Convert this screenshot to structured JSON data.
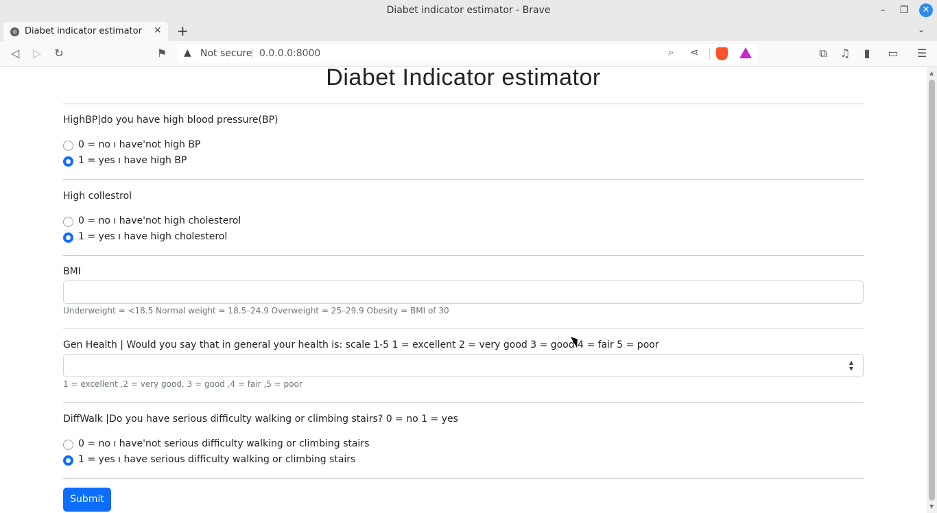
{
  "window": {
    "title": "Diabet indicator estimator - Brave"
  },
  "tab": {
    "title": "Diabet indicator estimator",
    "close_icon": "×",
    "new_tab_icon": "+",
    "list_icon": "⌄"
  },
  "addressbar": {
    "security_label": "Not secure",
    "url": "0.0.0.0:8000"
  },
  "page": {
    "heading": "Diabet İndicator estimator",
    "highbp": {
      "label": "HighBP|do you have high blood pressure(BP)",
      "options": [
        "0 = no ı have'not high BP",
        "1 = yes ı have high BP"
      ],
      "selected": 1
    },
    "highchol": {
      "label": "High collestrol",
      "options": [
        "0 = no ı have'not high cholesterol",
        "1 = yes ı have high cholesterol"
      ],
      "selected": 1
    },
    "bmi": {
      "label": "BMI",
      "value": "",
      "help": "Underweight = <18.5 Normal weight = 18.5–24.9 Overweight = 25–29.9 Obesity = BMI of 30"
    },
    "genhlth": {
      "label": "Gen Health | Would you say that in general your health is: scale 1-5 1 = excellent 2 = very good 3 = good 4 = fair 5 = poor",
      "value": "",
      "help": "1 = excellent ,2 = very good, 3 = good ,4 = fair ,5 = poor"
    },
    "diffwalk": {
      "label": "DiffWalk |Do you have serious difficulty walking or climbing stairs? 0 = no 1 = yes",
      "options": [
        "0 = no ı have'not serious difficulty walking or climbing stairs",
        "1 = yes ı have serious difficulty walking or climbing stairs"
      ],
      "selected": 1
    },
    "submit_label": "Submit"
  },
  "colors": {
    "primary": "#0d6efd",
    "brave_orange": "#fb542b",
    "close_button": "#2d8ceb"
  }
}
